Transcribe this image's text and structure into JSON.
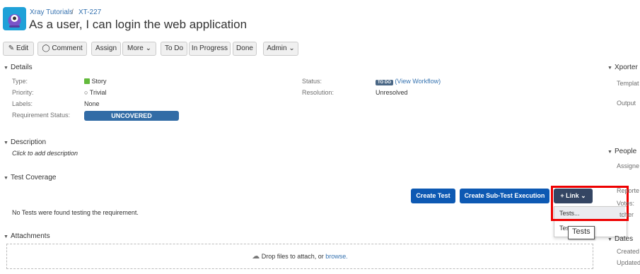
{
  "breadcrumb": {
    "project": "Xray Tutorials",
    "separator": "/",
    "issue_key": "XT-227"
  },
  "issue": {
    "title": "As a user, I can login the web application"
  },
  "toolbar": {
    "edit": "Edit",
    "comment": "Comment",
    "assign": "Assign",
    "more": "More",
    "todo": "To Do",
    "in_progress": "In Progress",
    "done": "Done",
    "admin": "Admin"
  },
  "details": {
    "heading": "Details",
    "type_label": "Type:",
    "type_value": "Story",
    "priority_label": "Priority:",
    "priority_value": "Trivial",
    "labels_label": "Labels:",
    "labels_value": "None",
    "req_status_label": "Requirement Status:",
    "req_status_value": "UNCOVERED",
    "status_label": "Status:",
    "status_badge": "TO DO",
    "status_link": "(View Workflow)",
    "resolution_label": "Resolution:",
    "resolution_value": "Unresolved"
  },
  "description": {
    "heading": "Description",
    "placeholder": "Click to add description"
  },
  "coverage": {
    "heading": "Test Coverage",
    "create_test": "Create Test",
    "create_sub": "Create Sub-Test Execution",
    "link": "Link",
    "empty": "No Tests were found testing the requirement.",
    "dropdown": [
      "Tests...",
      "Tes"
    ],
    "tooltip": "Tests"
  },
  "attachments": {
    "heading": "Attachments",
    "drop_text": "Drop files to attach, or",
    "browse": "browse."
  },
  "sidebar": {
    "xporter": "Xporter",
    "template": "Templat",
    "output": "Output",
    "people": "People",
    "assignee": "Assigne",
    "reporter": "Reporte",
    "votes": "Votes:",
    "watchers": "tcher",
    "dates": "Dates",
    "created": "Created",
    "updated": "Updated"
  },
  "colors": {
    "accent": "#3572b0",
    "primary_button": "#0d59b3",
    "highlight": "#e00000"
  }
}
